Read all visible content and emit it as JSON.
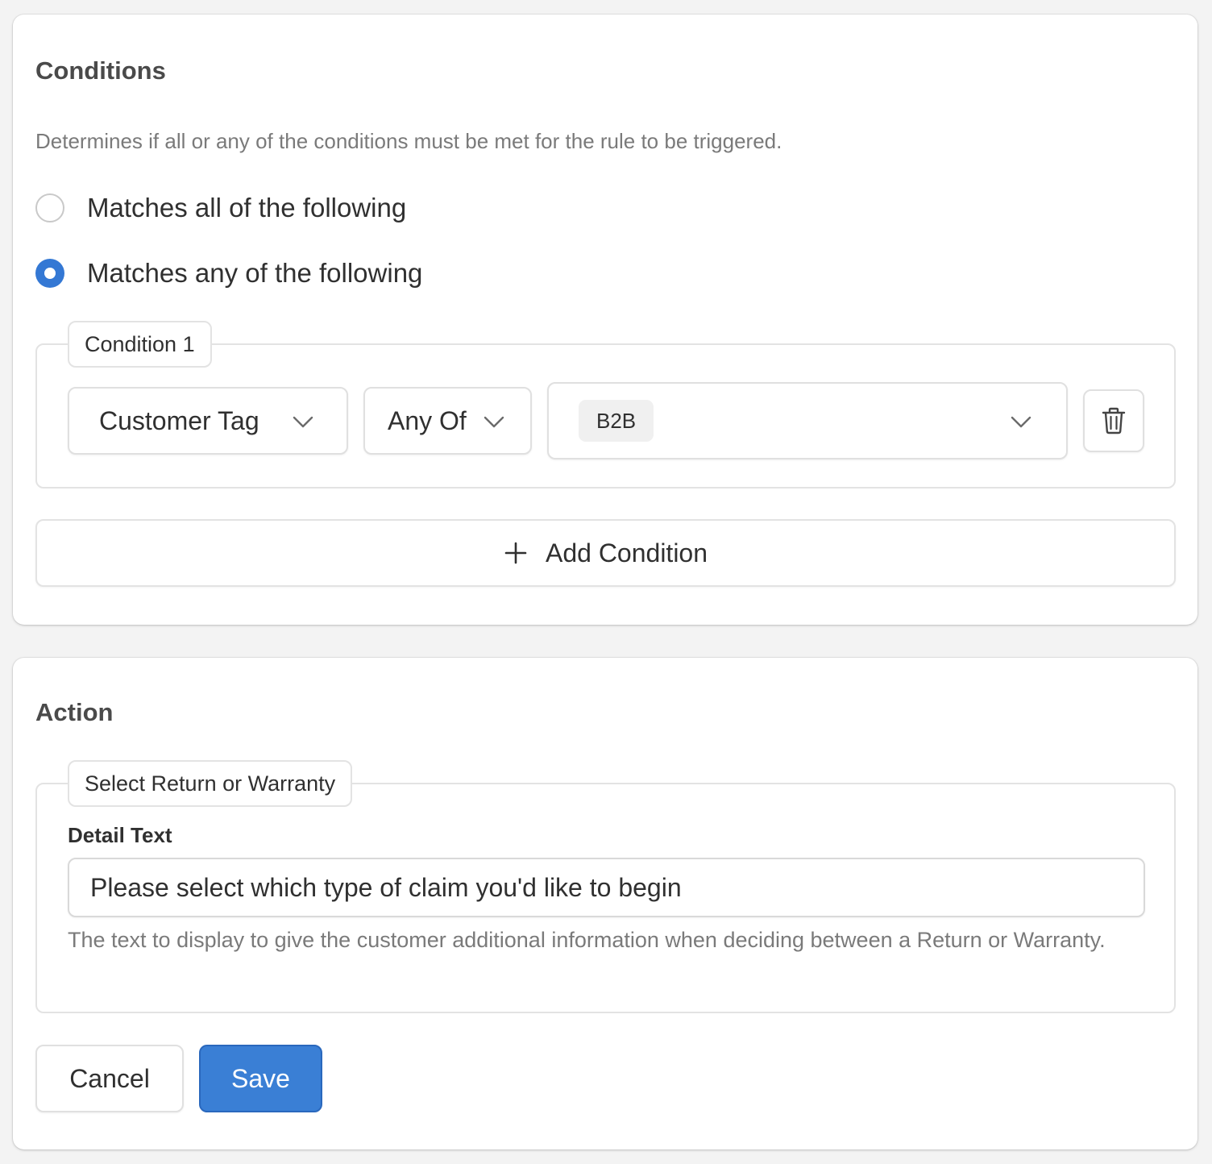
{
  "colors": {
    "accent": "#3a7fd5",
    "page_background": "#f3f3f3",
    "card_background": "#ffffff",
    "muted_text": "#7a7a7a",
    "tag_background": "#f0f0f0"
  },
  "conditions": {
    "title": "Conditions",
    "description": "Determines if all or any of the conditions must be met for the rule to be triggered.",
    "match_options": [
      {
        "label": "Matches all of the following",
        "selected": false
      },
      {
        "label": "Matches any of the following",
        "selected": true
      }
    ],
    "items": [
      {
        "legend": "Condition 1",
        "field": "Customer Tag",
        "operator": "Any Of",
        "values": [
          "B2B"
        ],
        "delete_icon": "trash-icon"
      }
    ],
    "add_button_label": "Add Condition",
    "add_icon": "plus-icon"
  },
  "action": {
    "title": "Action",
    "legend": "Select Return or Warranty",
    "detail_label": "Detail Text",
    "detail_value": "Please select which type of claim you'd like to begin",
    "help_text": "The text to display to give the customer additional information when deciding between a Return or Warranty."
  },
  "footer": {
    "cancel_label": "Cancel",
    "save_label": "Save"
  }
}
